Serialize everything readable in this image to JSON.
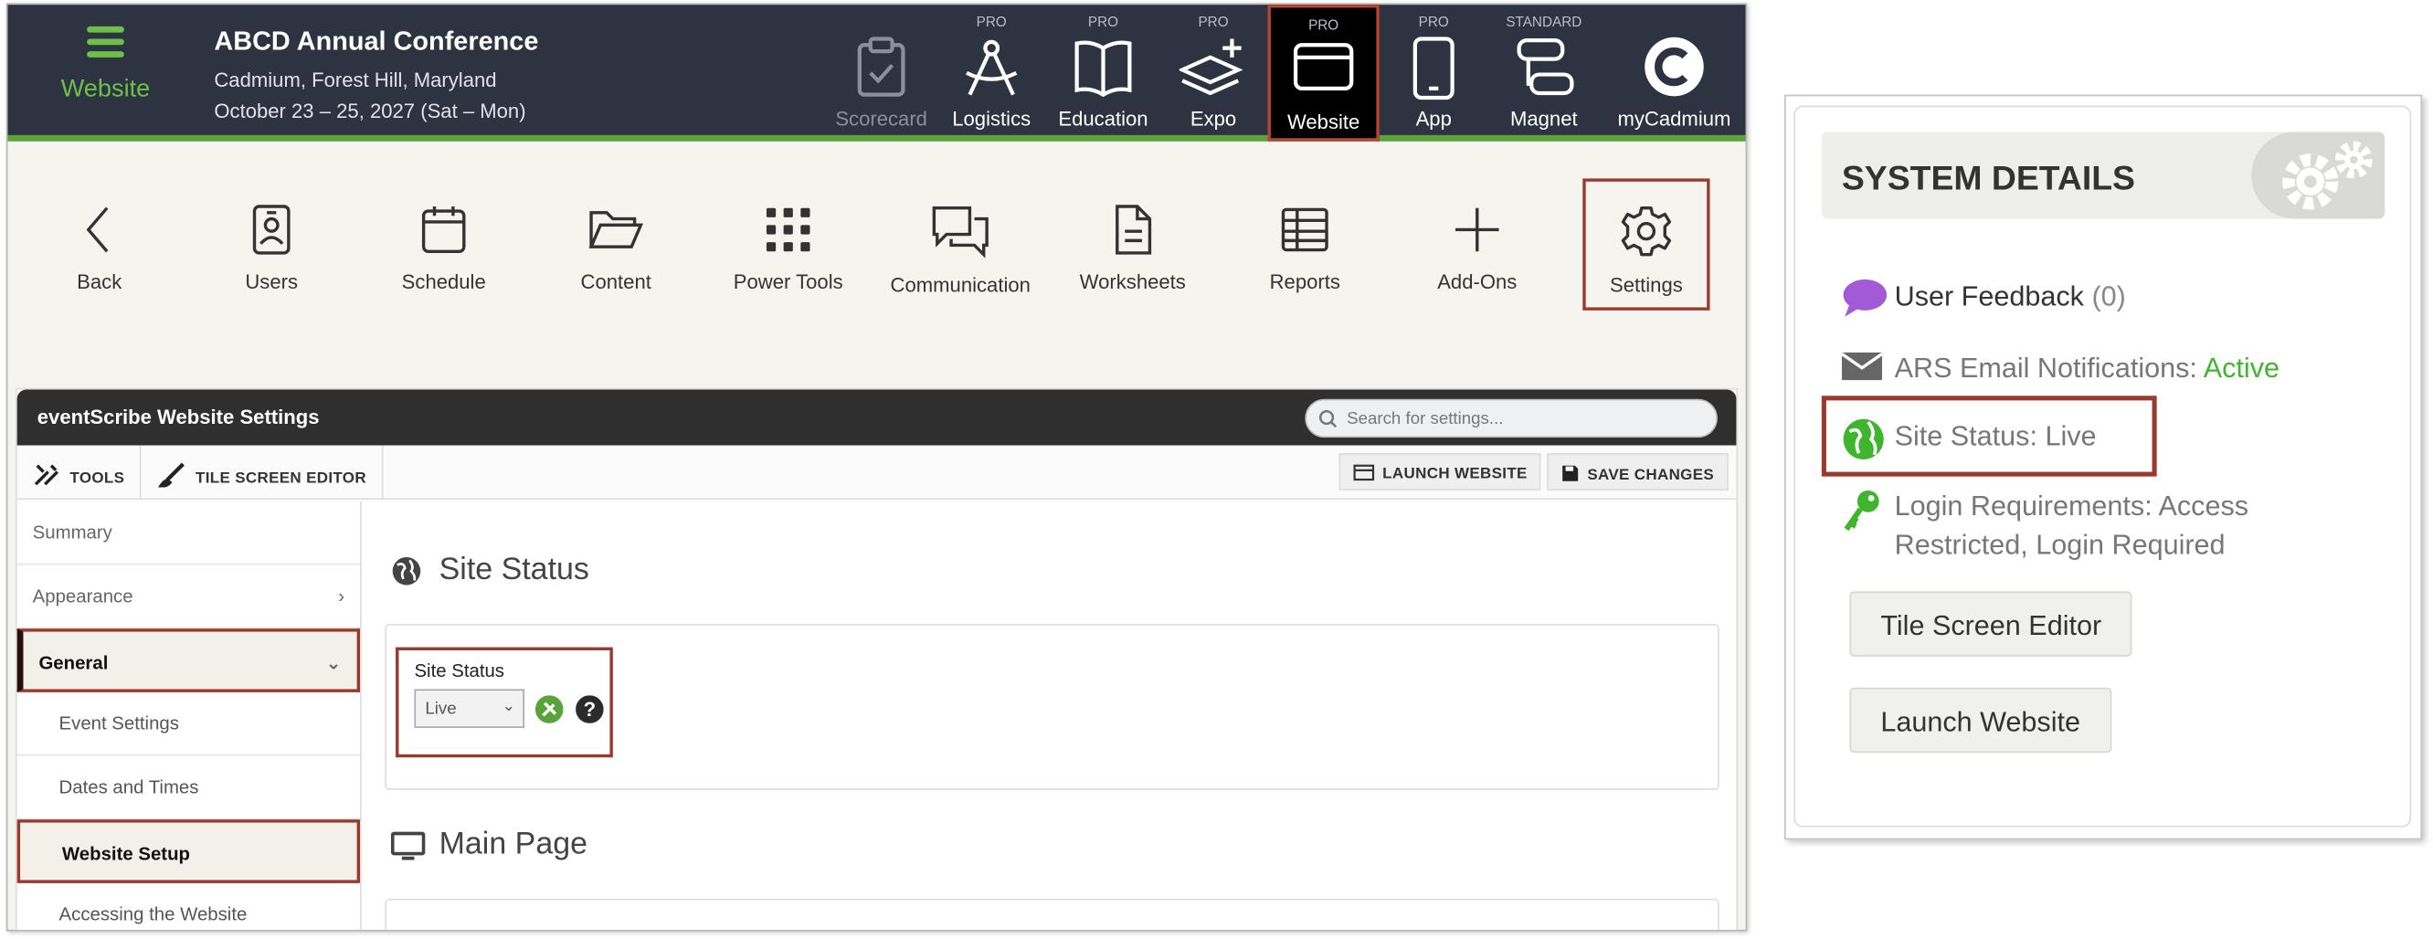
{
  "header": {
    "brand_label": "Website",
    "event_title": "ABCD Annual Conference",
    "event_location": "Cadmium, Forest Hill, Maryland",
    "event_dates": "October 23 – 25, 2027 (Sat – Mon)"
  },
  "modules": [
    {
      "label": "Scorecard",
      "tier": "",
      "icon": "clipboard-check-icon"
    },
    {
      "label": "Logistics",
      "tier": "PRO",
      "icon": "compass-icon"
    },
    {
      "label": "Education",
      "tier": "PRO",
      "icon": "book-icon"
    },
    {
      "label": "Expo",
      "tier": "PRO",
      "icon": "layers-plus-icon"
    },
    {
      "label": "Website",
      "tier": "PRO",
      "icon": "browser-window-icon"
    },
    {
      "label": "App",
      "tier": "PRO",
      "icon": "smartphone-icon"
    },
    {
      "label": "Magnet",
      "tier": "STANDARD",
      "icon": "magnet-flow-icon"
    },
    {
      "label": "myCadmium",
      "tier": "",
      "icon": "cadmium-logo-icon"
    }
  ],
  "toolbar": [
    {
      "label": "Back",
      "icon": "chevron-left-icon"
    },
    {
      "label": "Users",
      "icon": "id-badge-icon"
    },
    {
      "label": "Schedule",
      "icon": "calendar-icon"
    },
    {
      "label": "Content",
      "icon": "folder-open-icon"
    },
    {
      "label": "Power Tools",
      "icon": "grid-dots-icon"
    },
    {
      "label": "Communication",
      "icon": "chat-bubbles-icon"
    },
    {
      "label": "Worksheets",
      "icon": "document-icon"
    },
    {
      "label": "Reports",
      "icon": "table-icon"
    },
    {
      "label": "Add-Ons",
      "icon": "plus-icon"
    },
    {
      "label": "Settings",
      "icon": "gear-icon"
    }
  ],
  "settings_window": {
    "title": "eventScribe Website Settings",
    "search_placeholder": "Search for settings...",
    "tools_label": "TOOLS",
    "tile_editor_label": "TILE SCREEN EDITOR",
    "launch_label": "LAUNCH WEBSITE",
    "save_label": "SAVE CHANGES"
  },
  "nav": {
    "summary": "Summary",
    "appearance": "Appearance",
    "general": "General",
    "event_settings": "Event Settings",
    "dates_times": "Dates and Times",
    "website_setup": "Website Setup",
    "accessing": "Accessing the Website"
  },
  "main": {
    "section1_title": "Site Status",
    "field_label": "Site Status",
    "select_value": "Live",
    "section2_title": "Main Page"
  },
  "system_details": {
    "title": "SYSTEM DETAILS",
    "feedback_label": "User Feedback",
    "feedback_count": "(0)",
    "email_label": "ARS Email Notifications:",
    "email_status": "Active",
    "site_status": "Site Status: Live",
    "login_line1": "Login Requirements: Access",
    "login_line2": "Restricted, Login Required",
    "tile_button": "Tile Screen Editor",
    "launch_button": "Launch Website"
  },
  "colors": {
    "header_bg": "#2d3340",
    "accent_green": "#6cc04a",
    "highlight_red": "#9b3a2c",
    "active_green": "#3fb52d"
  }
}
